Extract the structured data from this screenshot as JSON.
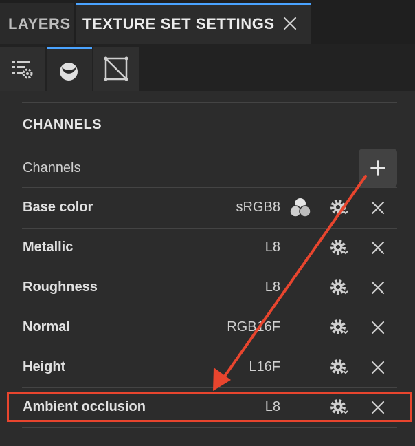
{
  "tabs": {
    "layers_label": "LAYERS",
    "texture_set_label": "TEXTURE SET SETTINGS"
  },
  "toolbar": {
    "active_tool": "material-ball-icon",
    "tools": [
      "settings-list-icon",
      "material-ball-icon",
      "uv-square-icon"
    ]
  },
  "section": {
    "heading": "CHANNELS",
    "channels_label": "Channels"
  },
  "channels": [
    {
      "name": "Base color",
      "format": "sRGB8",
      "has_color_icon": true
    },
    {
      "name": "Metallic",
      "format": "L8"
    },
    {
      "name": "Roughness",
      "format": "L8"
    },
    {
      "name": "Normal",
      "format": "RGB16F"
    },
    {
      "name": "Height",
      "format": "L16F"
    },
    {
      "name": "Ambient occlusion",
      "format": "L8",
      "highlighted": true
    }
  ],
  "colors": {
    "accent": "#4aa3ff",
    "annotation": "#e8452e",
    "background": "#2c2c2c"
  }
}
